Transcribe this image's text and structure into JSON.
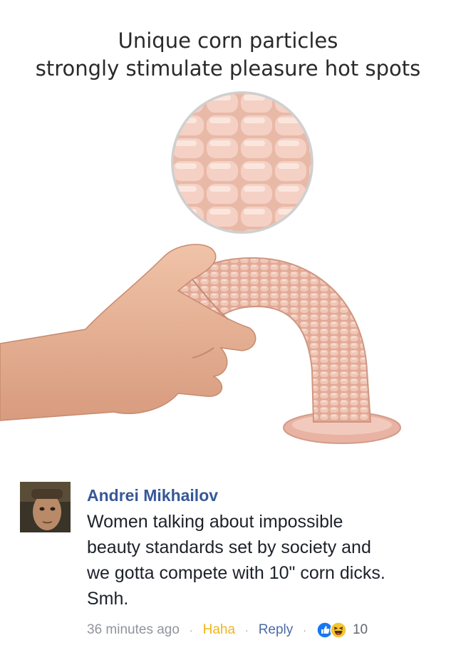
{
  "ad": {
    "title_line1": "Unique corn particles",
    "title_line2": "strongly stimulate pleasure hot spots"
  },
  "comment": {
    "author": "Andrei Mikhailov",
    "text_lines": [
      "Women talking about impossible",
      "beauty standards set by society and",
      "we gotta compete with 10\" corn dicks.",
      "Smh."
    ],
    "timestamp": "36 minutes ago",
    "separator": "·",
    "haha_label": "Haha",
    "reply_label": "Reply",
    "reaction_count": "10",
    "reaction_icons": [
      "like-icon",
      "haha-icon"
    ]
  },
  "colors": {
    "author": "#365899",
    "haha": "#f0b618",
    "reply": "#4b6aa8",
    "meta": "#90949c",
    "like": "#1877f2"
  }
}
